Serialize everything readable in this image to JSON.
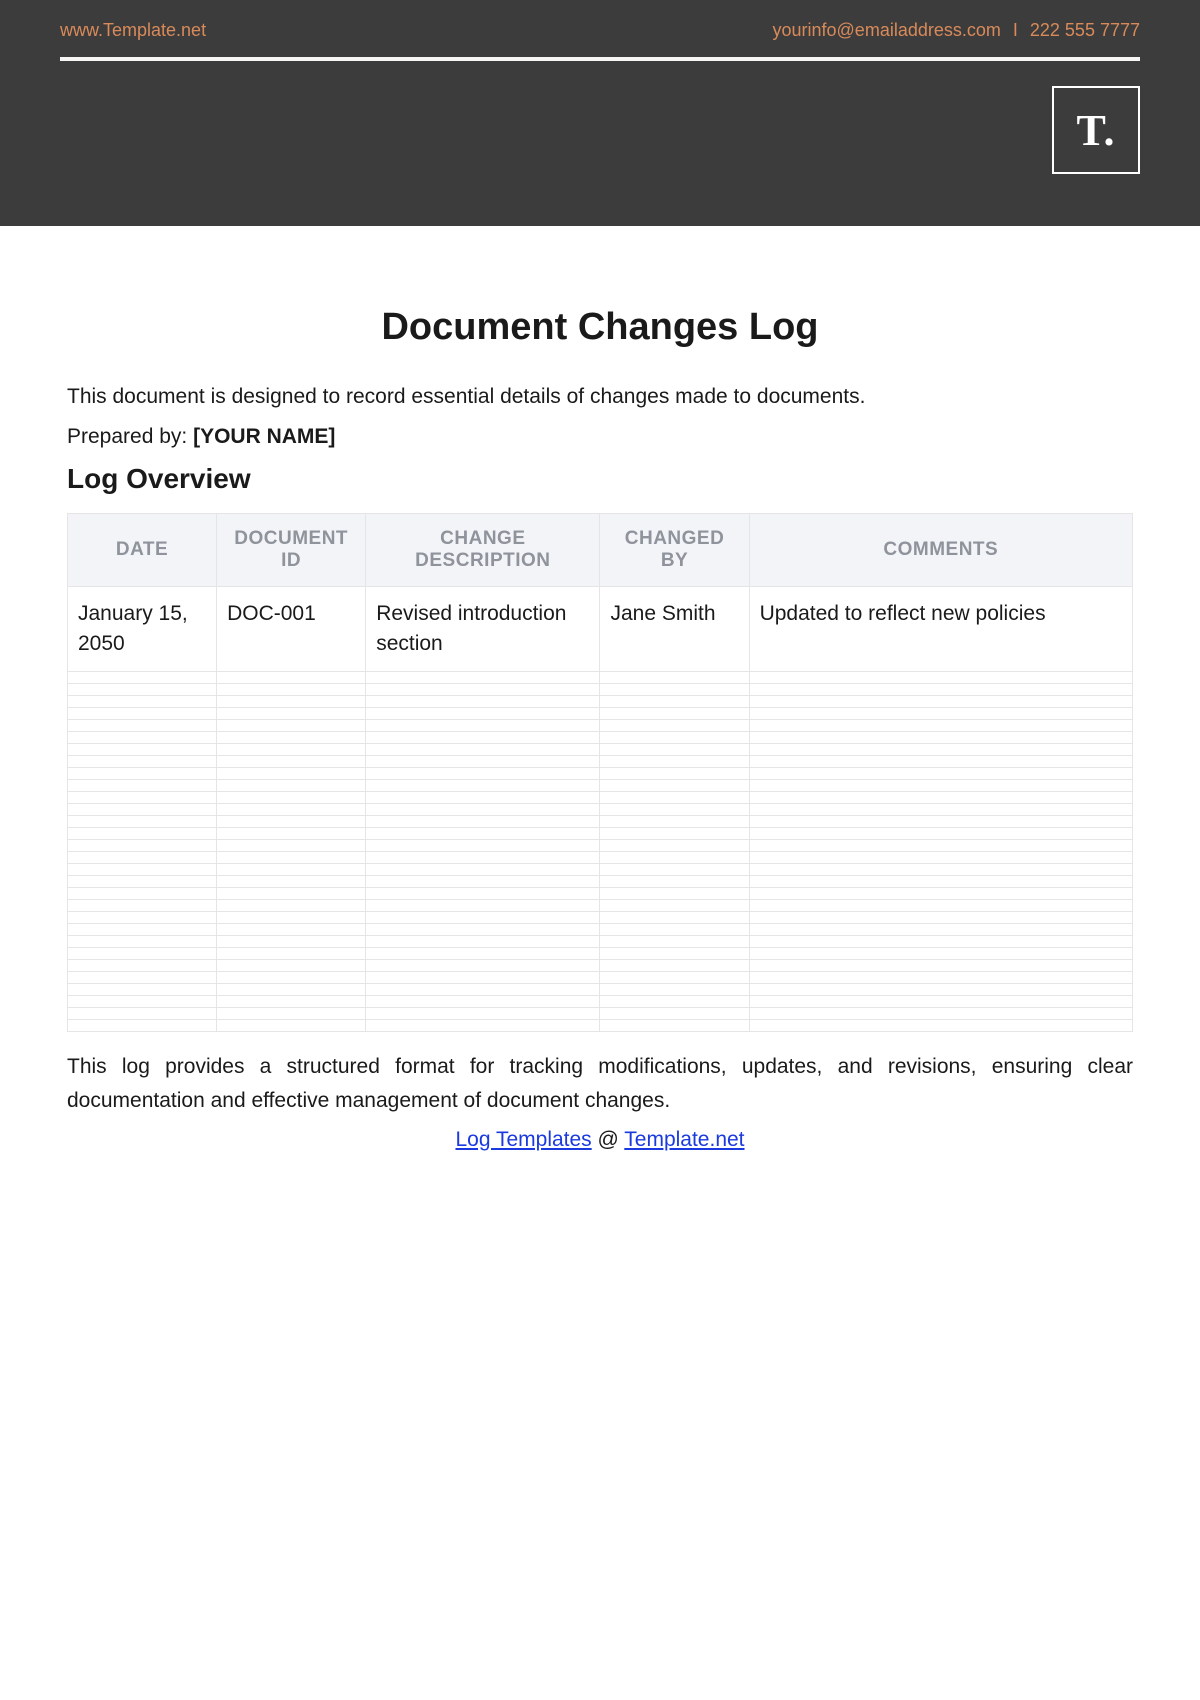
{
  "header": {
    "site": "www.Template.net",
    "email": "yourinfo@emailaddress.com",
    "separator": "I",
    "phone": "222 555 7777",
    "logo": "T."
  },
  "title": "Document Changes Log",
  "intro": "This document is designed to record essential details of changes made to documents.",
  "prepared_label": "Prepared by: ",
  "prepared_value": "[YOUR NAME]",
  "section_title": "Log Overview",
  "table": {
    "headers": [
      "DATE",
      "DOCUMENT ID",
      "CHANGE DESCRIPTION",
      "CHANGED BY",
      "COMMENTS"
    ],
    "row": {
      "date": "January 15, 2050",
      "doc_id": "DOC-001",
      "description": "Revised introduction section",
      "changed_by": "Jane Smith",
      "comments": "Updated to reflect new policies"
    },
    "blank_rows": 30
  },
  "closing": "This log provides a structured format for tracking modifications, updates, and revisions, ensuring clear documentation and effective management of document changes.",
  "credit": {
    "link1": "Log Templates",
    "middle": " @ ",
    "link2": "Template.net"
  }
}
